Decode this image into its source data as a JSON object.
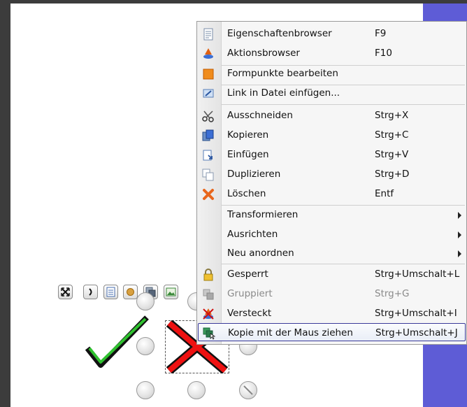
{
  "menu": {
    "items": [
      {
        "label": "Eigenschaftenbrowser",
        "shortcut": "F9",
        "icon": "properties-browser-icon"
      },
      {
        "label": "Aktionsbrowser",
        "shortcut": "F10",
        "icon": "actions-browser-icon"
      },
      {
        "label": "Formpunkte bearbeiten",
        "shortcut": "",
        "icon": "edit-shape-points-icon"
      },
      {
        "label": "Link in Datei einfügen...",
        "shortcut": "",
        "icon": "insert-link-icon"
      },
      {
        "label": "Ausschneiden",
        "shortcut": "Strg+X",
        "icon": "scissors-icon"
      },
      {
        "label": "Kopieren",
        "shortcut": "Strg+C",
        "icon": "copy-icon"
      },
      {
        "label": "Einfügen",
        "shortcut": "Strg+V",
        "icon": "paste-icon"
      },
      {
        "label": "Duplizieren",
        "shortcut": "Strg+D",
        "icon": "duplicate-icon"
      },
      {
        "label": "Löschen",
        "shortcut": "Entf",
        "icon": "delete-x-icon"
      },
      {
        "label": "Transformieren",
        "shortcut": "",
        "submenu": true
      },
      {
        "label": "Ausrichten",
        "shortcut": "",
        "submenu": true
      },
      {
        "label": "Neu anordnen",
        "shortcut": "",
        "submenu": true
      },
      {
        "label": "Gesperrt",
        "shortcut": "Strg+Umschalt+L",
        "icon": "padlock-icon"
      },
      {
        "label": "Gruppiert",
        "shortcut": "Strg+G",
        "icon": "group-icon",
        "disabled": true
      },
      {
        "label": "Versteckt",
        "shortcut": "Strg+Umschalt+I",
        "icon": "hidden-icon"
      },
      {
        "label": "Kopie mit der Maus ziehen",
        "shortcut": "Strg+Umschalt+J",
        "icon": "drag-copy-icon",
        "highlighted": true
      }
    ]
  },
  "toolbar": {
    "buttons": [
      "fit-icon",
      "rotate-icon",
      "properties-icon",
      "edit-points-icon",
      "stack-icon",
      "image-icon"
    ]
  },
  "canvas": {
    "shapes": [
      "green-checkmark",
      "red-x-mark"
    ]
  },
  "colors": {
    "accent_purple": "#5e5cd6",
    "menu_bg": "#f6f6f6",
    "highlight_border": "#3a3a9a",
    "check_green": "#2fc12f",
    "cross_red": "#ee1111"
  }
}
